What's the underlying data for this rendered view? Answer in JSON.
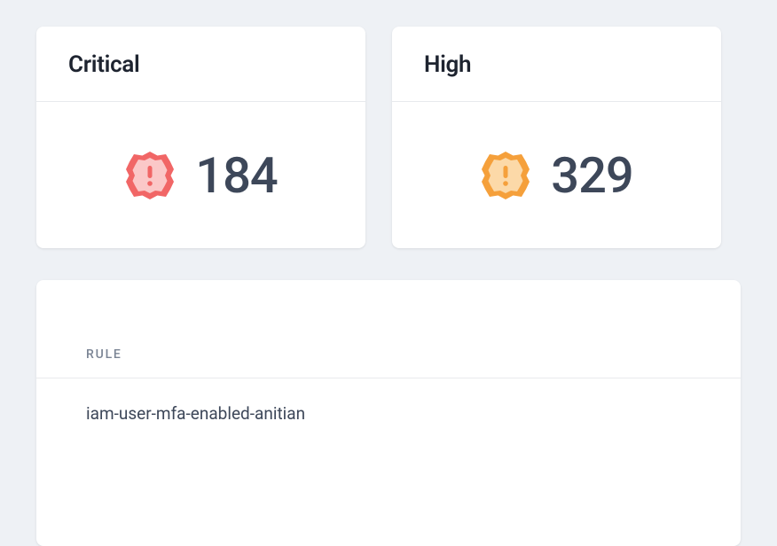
{
  "cards": [
    {
      "title": "Critical",
      "value": "184",
      "color_outer": "#f16666",
      "color_inner": "#fbc8c8"
    },
    {
      "title": "High",
      "value": "329",
      "color_outer": "#f5a03b",
      "color_inner": "#fcd9a8"
    }
  ],
  "table": {
    "header": "RULE",
    "rows": [
      "iam-user-mfa-enabled-anitian"
    ]
  }
}
